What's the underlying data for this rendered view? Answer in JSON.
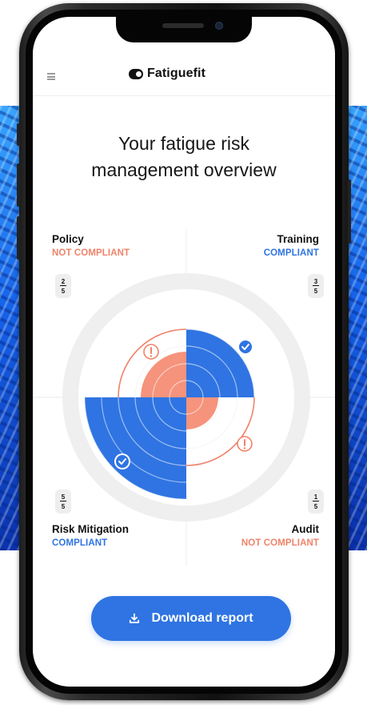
{
  "app": {
    "brand_name": "Fatiguefit",
    "brand_icon": "fatiguefit-logo-icon",
    "menu_icon": "hamburger-menu-icon"
  },
  "page": {
    "title_line1": "Your fatigue risk",
    "title_line2": "management overview"
  },
  "quadrants": {
    "policy": {
      "label": "Policy",
      "status": "NOT COMPLIANT",
      "score": "2",
      "total": "5",
      "score_fraction": 0.4,
      "compliant": false
    },
    "training": {
      "label": "Training",
      "status": "COMPLIANT",
      "score": "3",
      "total": "5",
      "score_fraction": 0.6,
      "compliant": true
    },
    "risk_mitigation": {
      "label": "Risk Mitigation",
      "status": "COMPLIANT",
      "score": "5",
      "total": "5",
      "score_fraction": 1.0,
      "compliant": true
    },
    "audit": {
      "label": "Audit",
      "status": "NOT COMPLIANT",
      "score": "1",
      "total": "5",
      "score_fraction": 0.2,
      "compliant": false
    }
  },
  "actions": {
    "download_label": "Download report",
    "download_icon": "download-icon"
  },
  "colors": {
    "compliant_blue": "#2f74e2",
    "not_compliant_red": "#f0836a",
    "not_compliant_fill": "#f6937c",
    "ring_gray": "#efefef"
  }
}
